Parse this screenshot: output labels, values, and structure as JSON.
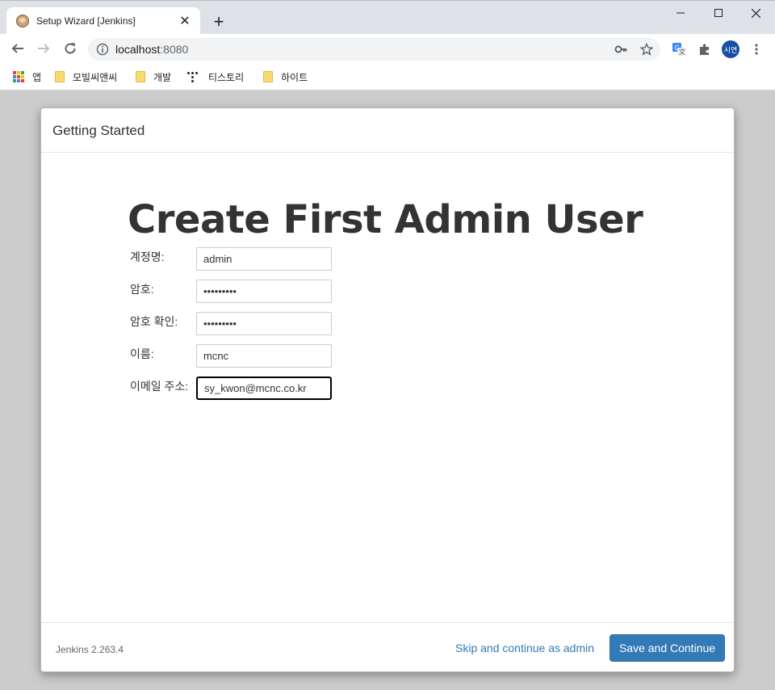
{
  "browser": {
    "tab_title": "Setup Wizard [Jenkins]",
    "url_host": "localhost",
    "url_port": ":8080",
    "avatar_text": "시연"
  },
  "bookmarks": [
    {
      "label": "앱",
      "icon": "apps-grid-icon"
    },
    {
      "label": "모빌씨앤씨",
      "icon": "folder-icon"
    },
    {
      "label": "개발",
      "icon": "folder-icon"
    },
    {
      "label": "티스토리",
      "icon": "tistory-icon"
    },
    {
      "label": "하이트",
      "icon": "folder-icon"
    }
  ],
  "wizard": {
    "header_title": "Getting Started",
    "title": "Create First Admin User",
    "fields": [
      {
        "label": "계정명:",
        "value": "admin",
        "type": "text"
      },
      {
        "label": "암호:",
        "value": "•••••••••",
        "type": "password"
      },
      {
        "label": "암호 확인:",
        "value": "•••••••••",
        "type": "password"
      },
      {
        "label": "이름:",
        "value": "mcnc",
        "type": "text"
      },
      {
        "label": "이메일 주소:",
        "value": "sy_kwon@mcnc.co.kr",
        "type": "email"
      }
    ],
    "version": "Jenkins 2.263.4",
    "skip_label": "Skip and continue as admin",
    "save_label": "Save and Continue"
  },
  "colors": {
    "primary": "#337ab7",
    "link": "#337ab7",
    "chrome_frame": "#dee1e6",
    "backdrop": "#cccccc"
  }
}
